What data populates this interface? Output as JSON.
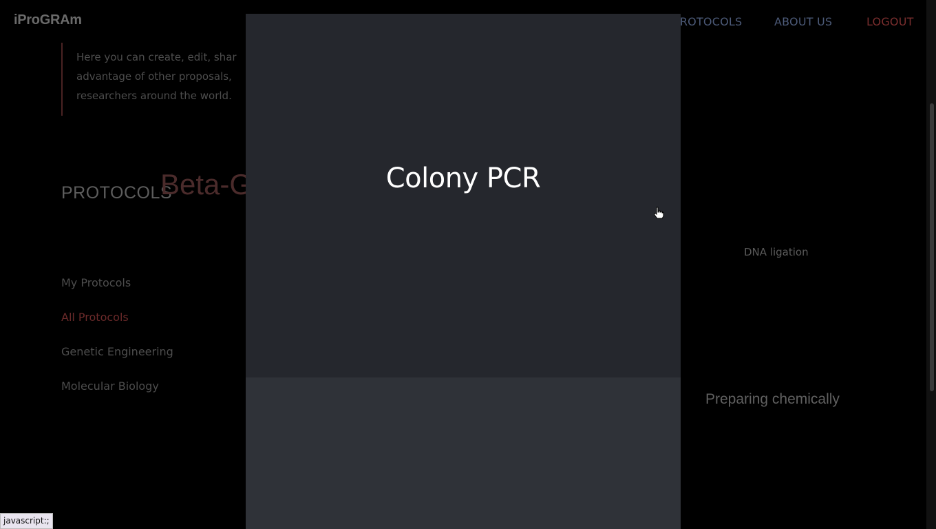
{
  "header": {
    "brand": "iProGRAm",
    "nav": [
      {
        "label": "PROTOCOLS"
      },
      {
        "label": "ABOUT US"
      },
      {
        "label": "LOGOUT"
      }
    ]
  },
  "intro": {
    "lines": [
      "Here you can create, edit, shar",
      "advantage of other proposals,",
      "researchers around the world."
    ]
  },
  "sidebar": {
    "title": "PROTOCOLS",
    "items": [
      {
        "label": "My Protocols"
      },
      {
        "label": "All Protocols",
        "active": true
      },
      {
        "label": "Genetic Engineering"
      },
      {
        "label": "Molecular Biology"
      }
    ]
  },
  "background_cards": {
    "peek_title": "Beta-G",
    "right_title_1": "DNA ligation",
    "right_title_2": "Preparing chemically"
  },
  "modal": {
    "title": "Colony PCR"
  },
  "statusbar": {
    "text": "javascript:;"
  },
  "colors": {
    "accent": "#7a2e2e",
    "modal_top": "#25272d",
    "modal_bottom": "#2f3238"
  }
}
